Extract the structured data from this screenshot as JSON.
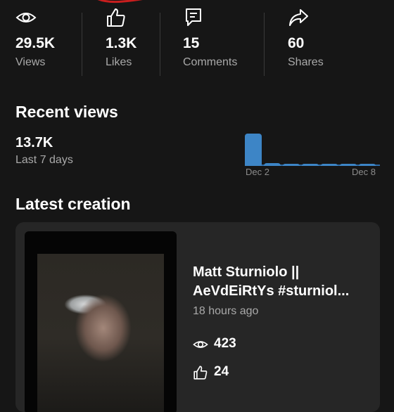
{
  "stats": [
    {
      "icon": "eye-icon",
      "value": "29.5K",
      "label": "Views"
    },
    {
      "icon": "thumbs-up-icon",
      "value": "1.3K",
      "label": "Likes"
    },
    {
      "icon": "comment-icon",
      "value": "15",
      "label": "Comments"
    },
    {
      "icon": "share-icon",
      "value": "60",
      "label": "Shares"
    }
  ],
  "recent_views": {
    "title": "Recent views",
    "value": "13.7K",
    "period": "Last 7 days",
    "chart_data": {
      "type": "bar",
      "x_start_label": "Dec 2",
      "x_end_label": "Dec 8",
      "values": [
        100,
        8,
        3,
        3,
        5,
        3,
        5
      ],
      "color": "#3d85c6"
    }
  },
  "latest_creation": {
    "title": "Latest creation",
    "video": {
      "title_line1": "Matt Sturniolo ||",
      "title_line2": "AeVdEiRtYs #sturniol...",
      "time": "18 hours ago",
      "views": "423",
      "likes": "24"
    }
  },
  "colors": {
    "background": "#161616",
    "card": "#262626",
    "accent": "#3d85c6",
    "annotation": "#c81e1e"
  }
}
